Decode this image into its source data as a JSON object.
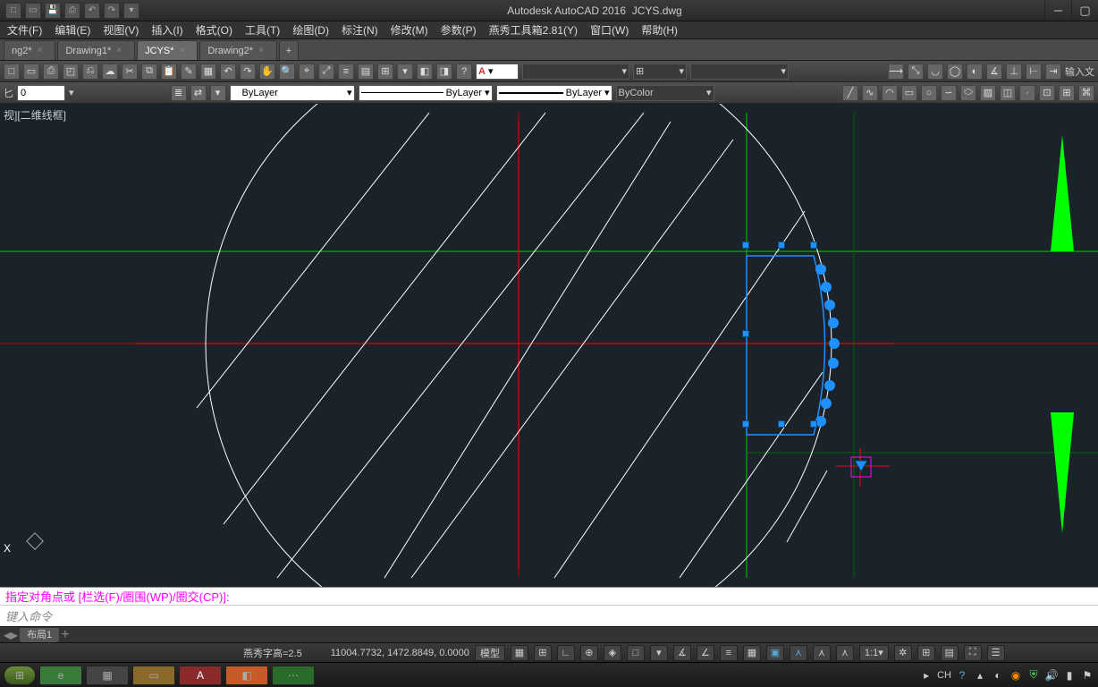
{
  "title": {
    "app": "Autodesk AutoCAD 2016",
    "file": "JCYS.dwg"
  },
  "menus": [
    "文件(F)",
    "编辑(E)",
    "视图(V)",
    "插入(I)",
    "格式(O)",
    "工具(T)",
    "绘图(D)",
    "标注(N)",
    "修改(M)",
    "参数(P)",
    "燕秀工具箱2.81(Y)",
    "窗口(W)",
    "帮助(H)"
  ],
  "tabs": [
    {
      "label": "ng2*",
      "active": false
    },
    {
      "label": "Drawing1*",
      "active": false
    },
    {
      "label": "JCYS*",
      "active": true
    },
    {
      "label": "Drawing2*",
      "active": false
    }
  ],
  "toolbar": {
    "input_label": "输入文",
    "scale_value": "0"
  },
  "props": {
    "layer": "ByLayer",
    "linetype": "ByLayer",
    "lineweight": "ByLayer",
    "color": "ByColor"
  },
  "viewport_label": "视][二维线框]",
  "cmd": {
    "output": "指定对角点或 [栏选(F)/圈围(WP)/圈交(CP)]:",
    "input_placeholder": "键入命令"
  },
  "layout": {
    "tab": "布局1"
  },
  "status": {
    "note": "燕秀字高=2.5",
    "coord": "11004.7732, 1472.8849, 0.0000",
    "mode": "模型",
    "scale": "1:1",
    "ime": "CH"
  }
}
